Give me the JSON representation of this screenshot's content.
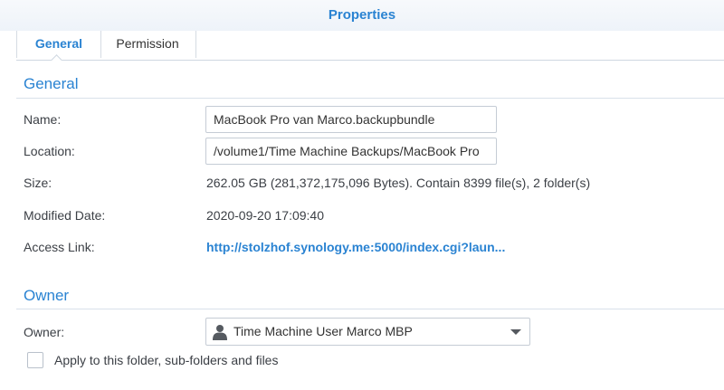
{
  "dialog": {
    "title": "Properties"
  },
  "tabs": [
    {
      "label": "General",
      "active": true
    },
    {
      "label": "Permission",
      "active": false
    }
  ],
  "general": {
    "section_title": "General",
    "name": {
      "label": "Name:",
      "value": "MacBook Pro van Marco.backupbundle"
    },
    "location": {
      "label": "Location:",
      "value": "/volume1/Time Machine Backups/MacBook Pro"
    },
    "size": {
      "label": "Size:",
      "value": "262.05 GB (281,372,175,096 Bytes). Contain 8399 file(s), 2 folder(s)"
    },
    "modified": {
      "label": "Modified Date:",
      "value": "2020-09-20 17:09:40"
    },
    "access_link": {
      "label": "Access Link:",
      "value": "http://stolzhof.synology.me:5000/index.cgi?laun..."
    }
  },
  "owner": {
    "section_title": "Owner",
    "label": "Owner:",
    "selected": "Time Machine User Marco MBP",
    "icon": "user-icon",
    "apply_checkbox": {
      "label": "Apply to this folder, sub-folders and files",
      "checked": false
    }
  },
  "colors": {
    "accent": "#2a83d2",
    "text": "#3b3f45",
    "border": "#c5ccd5"
  }
}
